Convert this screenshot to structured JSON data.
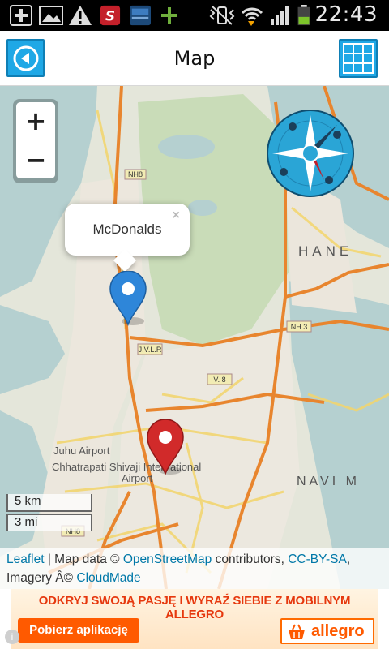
{
  "status_bar": {
    "time": "22:43",
    "icons": [
      "plus-icon",
      "image-icon",
      "warning-icon",
      "app-s-icon",
      "app-weather-icon",
      "android-icon",
      "vibrate-icon",
      "wifi-icon",
      "signal-icon",
      "battery-icon"
    ]
  },
  "header": {
    "title": "Map",
    "back_icon": "back-arrow-icon",
    "grid_icon": "grid-menu-icon"
  },
  "map": {
    "zoom_in_label": "+",
    "zoom_out_label": "−",
    "popup_text": "McDonalds",
    "popup_close": "×",
    "labels": {
      "nh8": "NH8",
      "thane": "HANE",
      "nh3": "NH 3",
      "jvlr": "J.V.L.R",
      "nh8b": "NH8",
      "airport1": "Juhu Airport",
      "airport2": "Chhatrapati Shivaji International",
      "airport3": "Airport",
      "navi": "NAVI  M",
      "route_v8": "V. 8"
    },
    "markers": [
      {
        "name": "blue-marker",
        "color": "#2e86d9"
      },
      {
        "name": "red-marker",
        "color": "#d12a2a"
      }
    ],
    "scale_km": "5 km",
    "scale_mi": "3 mi",
    "attribution": {
      "leaflet": "Leaflet",
      "sep1": " | Map data © ",
      "osm": "OpenStreetMap",
      "contributors": " contributors, ",
      "license": "CC-BY-SA",
      "comma": ",",
      "imagery": "Imagery Â© ",
      "cloudmade": "CloudMade"
    }
  },
  "ad": {
    "headline": "ODKRYJ SWOJĄ PASJĘ I WYRAŹ SIEBIE Z MOBILNYM ALLEGRO",
    "cta": "Pobierz aplikację",
    "brand": "allegro",
    "info": "i"
  },
  "colors": {
    "accent": "#1fa8e6",
    "water": "#b5d0d0",
    "park": "#c9dcb8",
    "road_major": "#e8852e",
    "road_minor": "#f3d56b",
    "ad_orange": "#ff5a00"
  }
}
